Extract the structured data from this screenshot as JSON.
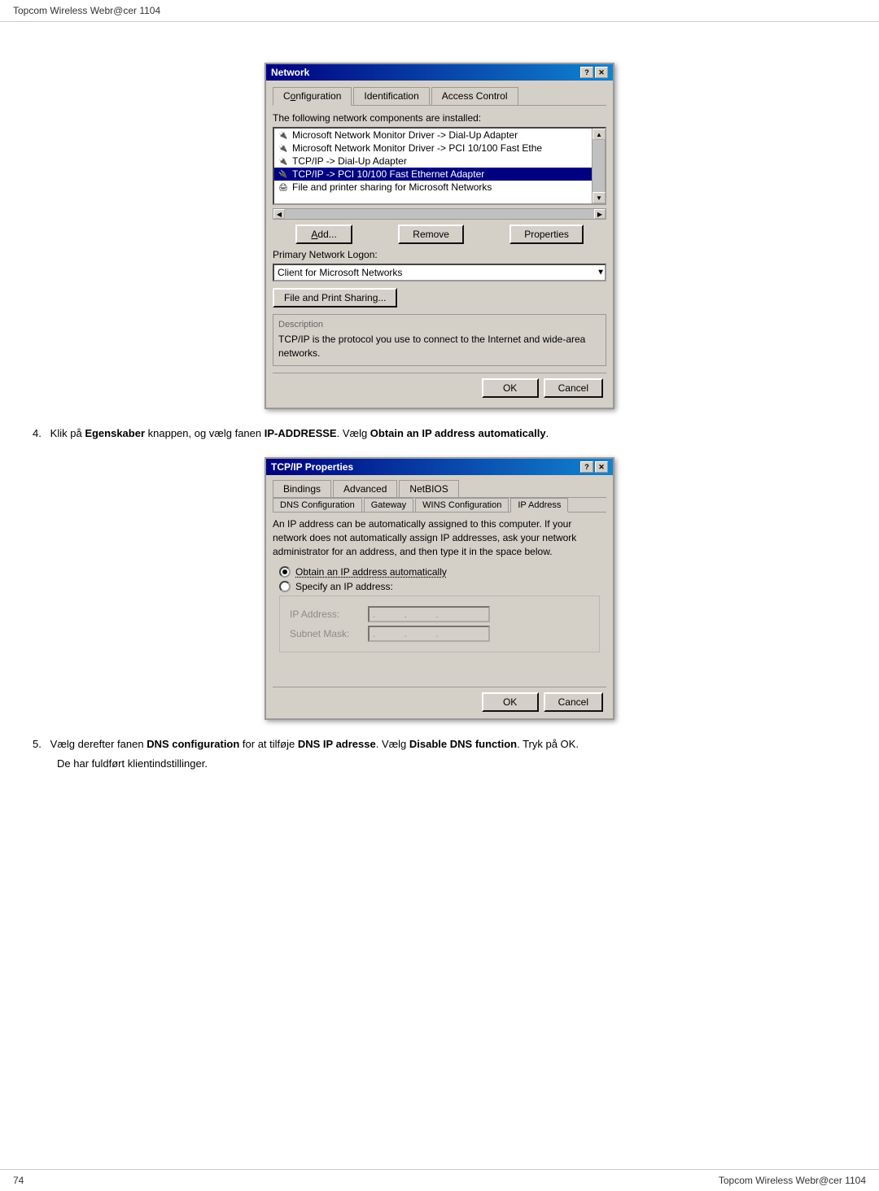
{
  "header": {
    "title": "Topcom Wireless Webr@cer 1104"
  },
  "footer": {
    "page_num": "74",
    "title_right": "Topcom Wireless Webr@cer 1104"
  },
  "network_dialog": {
    "title": "Network",
    "title_buttons": [
      "?",
      "×"
    ],
    "tabs": [
      "Configuration",
      "Identification",
      "Access Control"
    ],
    "description_text": "The following network components are installed:",
    "list_items": [
      {
        "icon": "net",
        "text": "Microsoft Network Monitor Driver -> Dial-Up Adapter",
        "selected": false
      },
      {
        "icon": "net",
        "text": "Microsoft Network Monitor Driver -> PCI 10/100 Fast Ethe",
        "selected": false
      },
      {
        "icon": "net",
        "text": "TCP/IP -> Dial-Up Adapter",
        "selected": false
      },
      {
        "icon": "net",
        "text": "TCP/IP -> PCI 10/100 Fast Ethernet Adapter",
        "selected": true
      },
      {
        "icon": "file",
        "text": "File and printer sharing for Microsoft Networks",
        "selected": false
      }
    ],
    "buttons": [
      "Add...",
      "Remove",
      "Properties"
    ],
    "primary_network_logon_label": "Primary Network Logon:",
    "primary_network_logon_value": "Client for Microsoft Networks",
    "file_print_sharing_btn": "File and Print Sharing...",
    "desc_section_title": "Description",
    "desc_text": "TCP/IP is the protocol you use to connect to the Internet and wide-area networks.",
    "ok_btn": "OK",
    "cancel_btn": "Cancel"
  },
  "step4_text": {
    "prefix": "4.   Klik på ",
    "bold1": "Egenskaber",
    "mid1": " knappen, og vælg fanen ",
    "bold2": "IP-ADDRESSE",
    "mid2": ". Vælg ",
    "bold3": "Obtain an IP address automatically",
    "suffix": "."
  },
  "tcpip_dialog": {
    "title": "TCP/IP Properties",
    "title_buttons": [
      "?",
      "×"
    ],
    "tabs_row1": [
      "Bindings",
      "Advanced",
      "NetBIOS"
    ],
    "tabs_row2": [
      "DNS Configuration",
      "Gateway",
      "WINS Configuration",
      "IP Address"
    ],
    "active_tab": "IP Address",
    "desc_text": "An IP address can be automatically assigned to this computer. If your network does not automatically assign IP addresses, ask your network administrator for an address, and then type it in the space below.",
    "radio_auto": "Obtain an IP address automatically",
    "radio_specify": "Specify an IP address:",
    "ip_address_label": "IP Address:",
    "subnet_mask_label": "Subnet Mask:",
    "ok_btn": "OK",
    "cancel_btn": "Cancel"
  },
  "step5_text": {
    "prefix": "5.   Vælg derefter fanen ",
    "bold1": "DNS configuration",
    "mid1": " for at tilføje ",
    "bold2": "DNS IP adresse",
    "mid2": ". Vælg ",
    "bold3": "Disable DNS function",
    "mid3": ". Tryk på OK.",
    "line2": "De har fuldført klientindstillinger."
  }
}
